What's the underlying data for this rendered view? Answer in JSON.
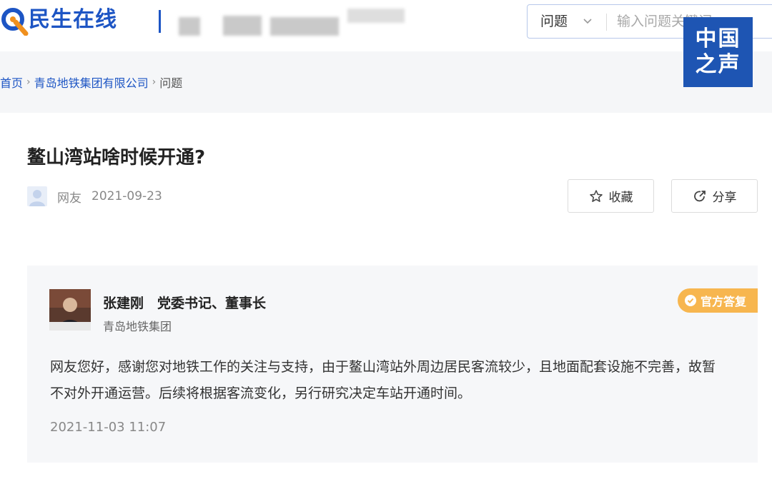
{
  "header": {
    "site_name": "民生在线",
    "search": {
      "category_selected": "问题",
      "placeholder": "输入问题关键词"
    },
    "cnr_logo": {
      "line1": "中国",
      "line2": "之声"
    }
  },
  "breadcrumb": {
    "items": [
      "首页",
      "青岛地铁集团有限公司"
    ],
    "current": "问题"
  },
  "question": {
    "title": "鳌山湾站啥时候开通?",
    "author": "网友",
    "date": "2021-09-23",
    "favorite_label": "收藏",
    "share_label": "分享"
  },
  "answer": {
    "official_name": "张建刚　党委书记、董事长",
    "official_org": "青岛地铁集团",
    "badge": "官方答复",
    "text": "网友您好，感谢您对地铁工作的关注与支持，由于鳌山湾站外周边居民客流较少，且地面配套设施不完善，故暂不对外开通运营。后续将根据客流变化，另行研究决定车站开通时间。",
    "time": "2021-11-03 11:07"
  },
  "colors": {
    "brand_blue": "#1d55c4",
    "logo_orange": "#f0901e",
    "badge_orange": "#f7b64f",
    "cnr_blue": "#1e55b3"
  }
}
